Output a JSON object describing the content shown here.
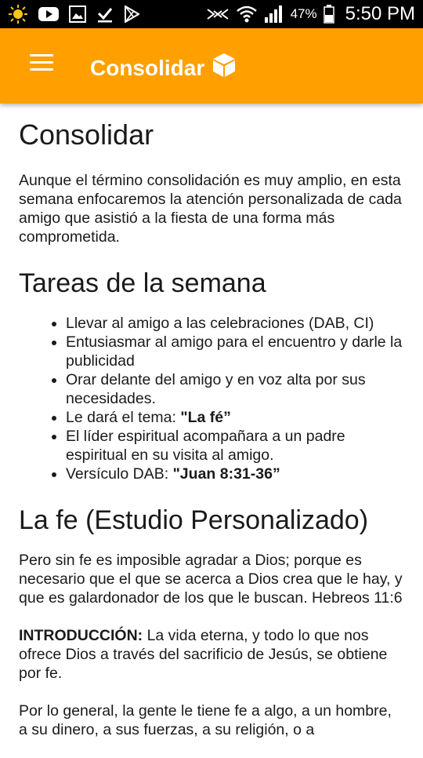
{
  "status_bar": {
    "battery_pct": "47%",
    "time": "5:50 PM",
    "icons": [
      "weather-sun-icon",
      "youtube-icon",
      "image-icon",
      "download-done-icon",
      "play-store-icon",
      "nfc-icon",
      "wifi-icon",
      "signal-icon",
      "battery-icon"
    ]
  },
  "app_bar": {
    "title": "Consolidar",
    "menu_icon": "menu-icon",
    "title_icon": "cube-icon",
    "color": "#ff9f00"
  },
  "content": {
    "heading": "Consolidar",
    "intro": "Aunque el término consolidación es muy amplio, en esta semana enfocaremos la atención personalizada de cada amigo que asistió a la fiesta de una forma más comprometida.",
    "tasks_heading": "Tareas de la semana",
    "tasks": [
      {
        "text": "Llevar al amigo a las celebraciones (DAB, CI)"
      },
      {
        "text": "Entusiasmar al amigo para el encuentro y darle la publicidad"
      },
      {
        "text": "Orar delante del amigo y en voz alta por sus necesidades."
      },
      {
        "text": "Le dará el tema: ",
        "bold": "\"La fé”"
      },
      {
        "text": "El líder espiritual acompañara a un padre espiritual en su visita al amigo."
      },
      {
        "text": "Versículo DAB: ",
        "bold": "\"Juan 8:31-36”"
      }
    ],
    "study_heading": "La fe (Estudio Personalizado)",
    "verse": "Pero sin fe es imposible agradar a Dios; porque es necesario que el que se acerca a Dios crea que le hay, y que es galardonador de los que le buscan. Hebreos 11:6",
    "intro_label": "INTRODUCCIÓN:",
    "intro_text": " La vida eterna, y todo lo que nos ofrece Dios a través del sacrificio de Jesús, se obtiene por fe.",
    "last_paragraph": "Por lo general, la gente le tiene fe a algo, a un hombre, a su dinero, a sus fuerzas, a su religión, o a"
  }
}
